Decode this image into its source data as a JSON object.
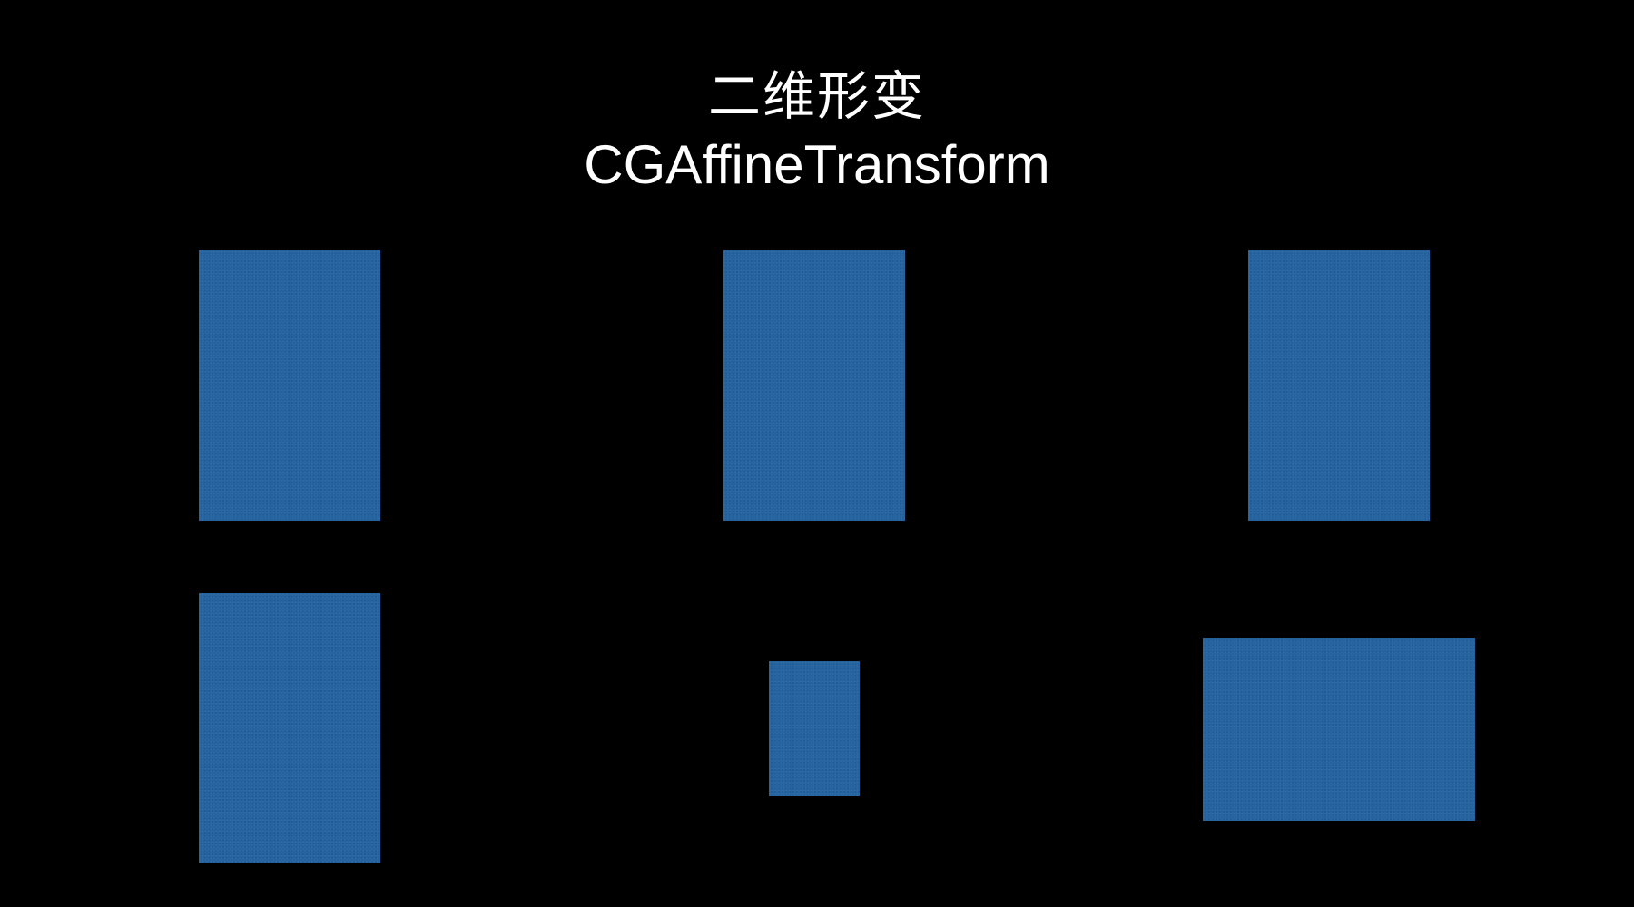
{
  "slide": {
    "title_zh": "二维形变",
    "title_en": "CGAffineTransform"
  },
  "colors": {
    "background": "#000000",
    "rect_fill": "#2462a0",
    "text": "#ffffff"
  }
}
